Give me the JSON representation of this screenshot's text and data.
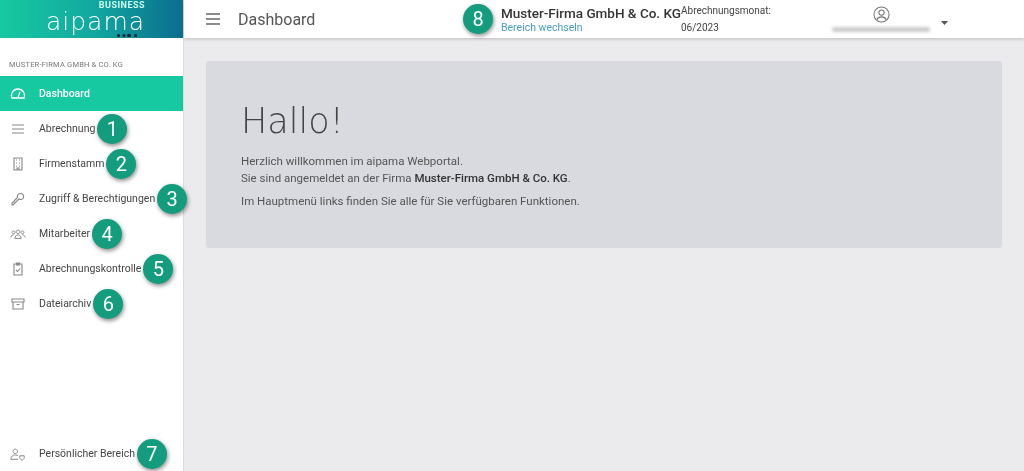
{
  "logo": {
    "name": "aipama",
    "tag": "BUSINESS"
  },
  "header": {
    "title": "Dashboard",
    "company": "Muster-Firma GmbH & Co. KG",
    "switch_link": "Bereich wechseln",
    "badge": "8",
    "month_label": "Abrechnungsmonat:",
    "month": "06/2023"
  },
  "sidebar": {
    "company": "MUSTER-FIRMA GMBH & CO. KG",
    "items": [
      {
        "label": "Dashboard",
        "selected": true
      },
      {
        "label": "Abrechnung",
        "selected": false,
        "badge": "1"
      },
      {
        "label": "Firmenstamm",
        "selected": false,
        "badge": "2"
      },
      {
        "label": "Zugriff & Berechtigungen",
        "selected": false,
        "badge": "3"
      },
      {
        "label": "Mitarbeiter",
        "selected": false,
        "badge": "4"
      },
      {
        "label": "Abrechnungskontrolle",
        "selected": false,
        "badge": "5"
      },
      {
        "label": "Dateiarchiv",
        "selected": false,
        "badge": "6"
      }
    ],
    "bottom_item": {
      "label": "Persönlicher Bereich",
      "selected": false,
      "badge": "7"
    }
  },
  "welcome": {
    "heading": "Hallo!",
    "lines": [
      "Herzlich willkommen im aipama Webportal.",
      "Sie sind angemeldet an der Firma **Muster-Firma GmbH & Co. KG**."
    ],
    "note": "Im Hauptmenü links finden Sie alle für Sie verfügbaren Funktionen."
  }
}
